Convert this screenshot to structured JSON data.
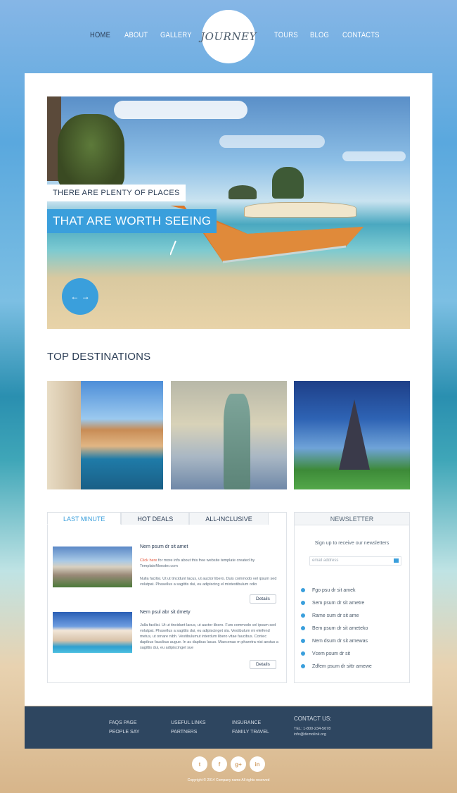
{
  "nav": {
    "items": [
      "HOME",
      "ABOUT",
      "GALLERY",
      "TOURS",
      "BLOG",
      "CONTACTS"
    ],
    "logo": "JOURNEY"
  },
  "hero": {
    "caption_top": "THERE ARE PLENTY OF PLACES",
    "caption_main": "THAT ARE WORTH SEEING",
    "arrows": "← →"
  },
  "destinations": {
    "title": "TOP DESTINATIONS"
  },
  "tabs": [
    "LAST MINUTE",
    "HOT DEALS",
    "ALL-INCLUSIVE"
  ],
  "deals": [
    {
      "title": "Nem psum dr sit amet",
      "link": "Click here",
      "line1": " for more info about this free website template created by",
      "line2": "TemplateMonster.com",
      "body": "Nulla facilisi. Ut ut tincidunt lacus, ut auctor libero. Duis commodo vel ipsum sed volutpat. Phasellus a sagittis dui, eu adipiscing el mixtestibulum odio",
      "button": "Details"
    },
    {
      "title": "Nem psul abr sit dmety",
      "body": "Julla facilisi. Ut ut tincidunt lacus, ut auctor libero. Furs commodo vel ipsum sed volutpat. Phasellus a sagittis dui, eu adipiscinget sla. Vestibulum mi eleifend metus, ut ornare nibh. Vestibulumut interdum libero vitae faucibus. Contec dapibus faucibus augue. In ac dapibus lacus. Maecenas m pharetra nisi aestus a sagittis dui, eu adipiscinget sue",
      "button": "Details"
    }
  ],
  "newsletter": {
    "title": "NEWSLETTER",
    "text": "Sign up to receive our newsletters",
    "placeholder": "email address",
    "items": [
      "Fgo psu dr sit amek",
      "Sem psum dr sit ametre",
      "Rame sum dr sit ame",
      "Bem psum dr sit ameteko",
      "Nem dsum dr sit amewas",
      "Vcem psum dr sit",
      "Zdfem psum dr sittr amewe"
    ]
  },
  "footer": {
    "col1": [
      "FAQS PAGE",
      "PEOPLE SAY"
    ],
    "col2": [
      "USEFUL LINKS",
      "PARTNERS"
    ],
    "col3": [
      "INSURANCE",
      "FAMILY TRAVEL"
    ],
    "contact_head": "CONTACT US:",
    "tel": "TEL: 1-800-234-5678",
    "email": "info@demolink.org"
  },
  "social": [
    "t",
    "f",
    "g+",
    "in"
  ],
  "copyright": "Copyright © 2014 Company name All rights reserved",
  "colors": {
    "accent": "#3a9fdc",
    "dark": "#2e4660"
  }
}
